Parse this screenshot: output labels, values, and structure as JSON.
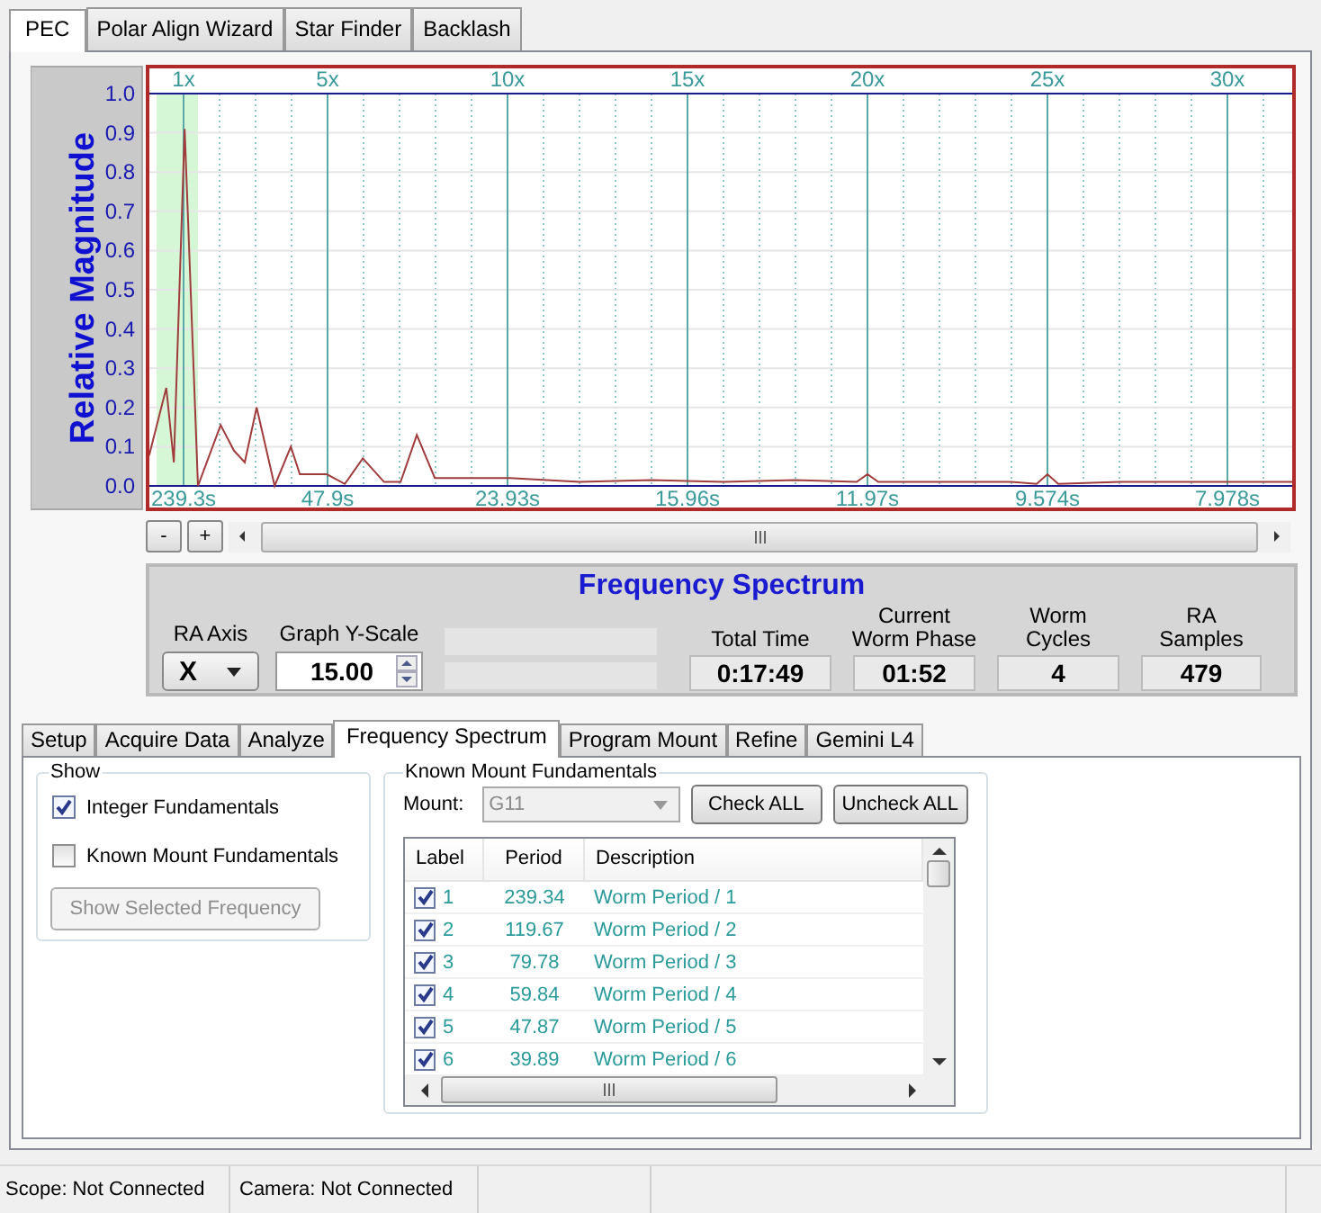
{
  "main_tabs": [
    {
      "label": "PEC",
      "selected": true
    },
    {
      "label": "Polar Align Wizard",
      "selected": false
    },
    {
      "label": "Star Finder",
      "selected": false
    },
    {
      "label": "Backlash",
      "selected": false
    }
  ],
  "chart": {
    "chart_data": {
      "type": "line",
      "ylabel": "Relative Magnitude",
      "xlim": [
        0,
        31.85
      ],
      "ylim": [
        0,
        1
      ],
      "yticks": [
        {
          "value": 0,
          "label": "0.0"
        },
        {
          "value": 0.1,
          "label": "0.1"
        },
        {
          "value": 0.2,
          "label": "0.2"
        },
        {
          "value": 0.3,
          "label": "0.3"
        },
        {
          "value": 0.4,
          "label": "0.4"
        },
        {
          "value": 0.5,
          "label": "0.5"
        },
        {
          "value": 0.6,
          "label": "0.6"
        },
        {
          "value": 0.7,
          "label": "0.7"
        },
        {
          "value": 0.8,
          "label": "0.8"
        },
        {
          "value": 0.9,
          "label": "0.9"
        },
        {
          "value": 1,
          "label": "1.0"
        }
      ],
      "xticks": [
        {
          "value": 1,
          "label": "1x"
        },
        {
          "value": 5,
          "label": "5x"
        },
        {
          "value": 10,
          "label": "10x"
        },
        {
          "value": 15,
          "label": "15x"
        },
        {
          "value": 20,
          "label": "20x"
        },
        {
          "value": 25,
          "label": "25x"
        },
        {
          "value": 30,
          "label": "30x"
        }
      ],
      "x": [
        0,
        0.05,
        0.52,
        0.73,
        1.03,
        1.4,
        2.03,
        2.4,
        2.7,
        3.03,
        3.53,
        3.98,
        4.23,
        4.98,
        5.48,
        5.98,
        6.57,
        7.03,
        7.48,
        7.98,
        9.07,
        10.07,
        12,
        14,
        16,
        18,
        19.7,
        20,
        20.3,
        22,
        24,
        24.7,
        25,
        25.3,
        27,
        29,
        31.85
      ],
      "grid": true,
      "series": [
        {
          "color": "#a03c3c",
          "values": [
            0.07,
            0.08,
            0.25,
            0.06,
            0.91,
            0,
            0.155,
            0.09,
            0.06,
            0.2,
            0,
            0.1,
            0.03,
            0.03,
            0.005,
            0.07,
            0.01,
            0.01,
            0.13,
            0.02,
            0.02,
            0.02,
            0.01,
            0.015,
            0.01,
            0.015,
            0.01,
            0.03,
            0.01,
            0.01,
            0.01,
            0.005,
            0.03,
            0.005,
            0.01,
            0.01,
            0.01
          ]
        }
      ],
      "annotations": [
        "239.3s",
        "47.9s",
        "23.93s",
        "15.96s",
        "11.97s",
        "9.574s",
        "7.978s"
      ]
    }
  },
  "zoom_buttons": [
    "-",
    "+"
  ],
  "summary": {
    "title": "Frequency Spectrum",
    "ra_axis": {
      "label": "RA Axis",
      "value": "X"
    },
    "y_scale": {
      "label": "Graph Y-Scale",
      "value": "15.00"
    },
    "stats": [
      {
        "label": "Total Time",
        "value": "0:17:49"
      },
      {
        "label": "Current Worm Phase",
        "value": "01:52"
      },
      {
        "label": "Worm Cycles",
        "value": "4"
      },
      {
        "label": "RA Samples",
        "value": "479"
      }
    ]
  },
  "sub_tabs": [
    {
      "label": "Setup",
      "selected": false
    },
    {
      "label": "Acquire Data",
      "selected": false
    },
    {
      "label": "Analyze",
      "selected": false
    },
    {
      "label": "Frequency Spectrum",
      "selected": true
    },
    {
      "label": "Program Mount",
      "selected": false
    },
    {
      "label": "Refine",
      "selected": false
    },
    {
      "label": "Gemini L4",
      "selected": false
    }
  ],
  "show_group": {
    "title": "Show",
    "options": [
      {
        "label": "Integer Fundamentals",
        "checked": true
      },
      {
        "label": "Known Mount Fundamentals",
        "checked": false
      }
    ],
    "button": {
      "label": "Show Selected Frequency",
      "disabled": true
    }
  },
  "known_group": {
    "title": "Known Mount Fundamentals",
    "mount_label": "Mount:",
    "mount_value": "G11",
    "mount_disabled": true,
    "buttons": [
      "Check ALL",
      "Uncheck ALL"
    ],
    "columns": [
      "Label",
      "Period",
      "Description"
    ],
    "rows": [
      {
        "checked": true,
        "label": "1",
        "period": "239.34",
        "description": "Worm Period / 1"
      },
      {
        "checked": true,
        "label": "2",
        "period": "119.67",
        "description": "Worm Period / 2"
      },
      {
        "checked": true,
        "label": "3",
        "period": "79.78",
        "description": "Worm Period / 3"
      },
      {
        "checked": true,
        "label": "4",
        "period": "59.84",
        "description": "Worm Period / 4"
      },
      {
        "checked": true,
        "label": "5",
        "period": "47.87",
        "description": "Worm Period / 5"
      },
      {
        "checked": true,
        "label": "6",
        "period": "39.89",
        "description": "Worm Period / 6"
      }
    ]
  },
  "status_bar": [
    "Scope: Not Connected",
    "Camera: Not Connected"
  ]
}
